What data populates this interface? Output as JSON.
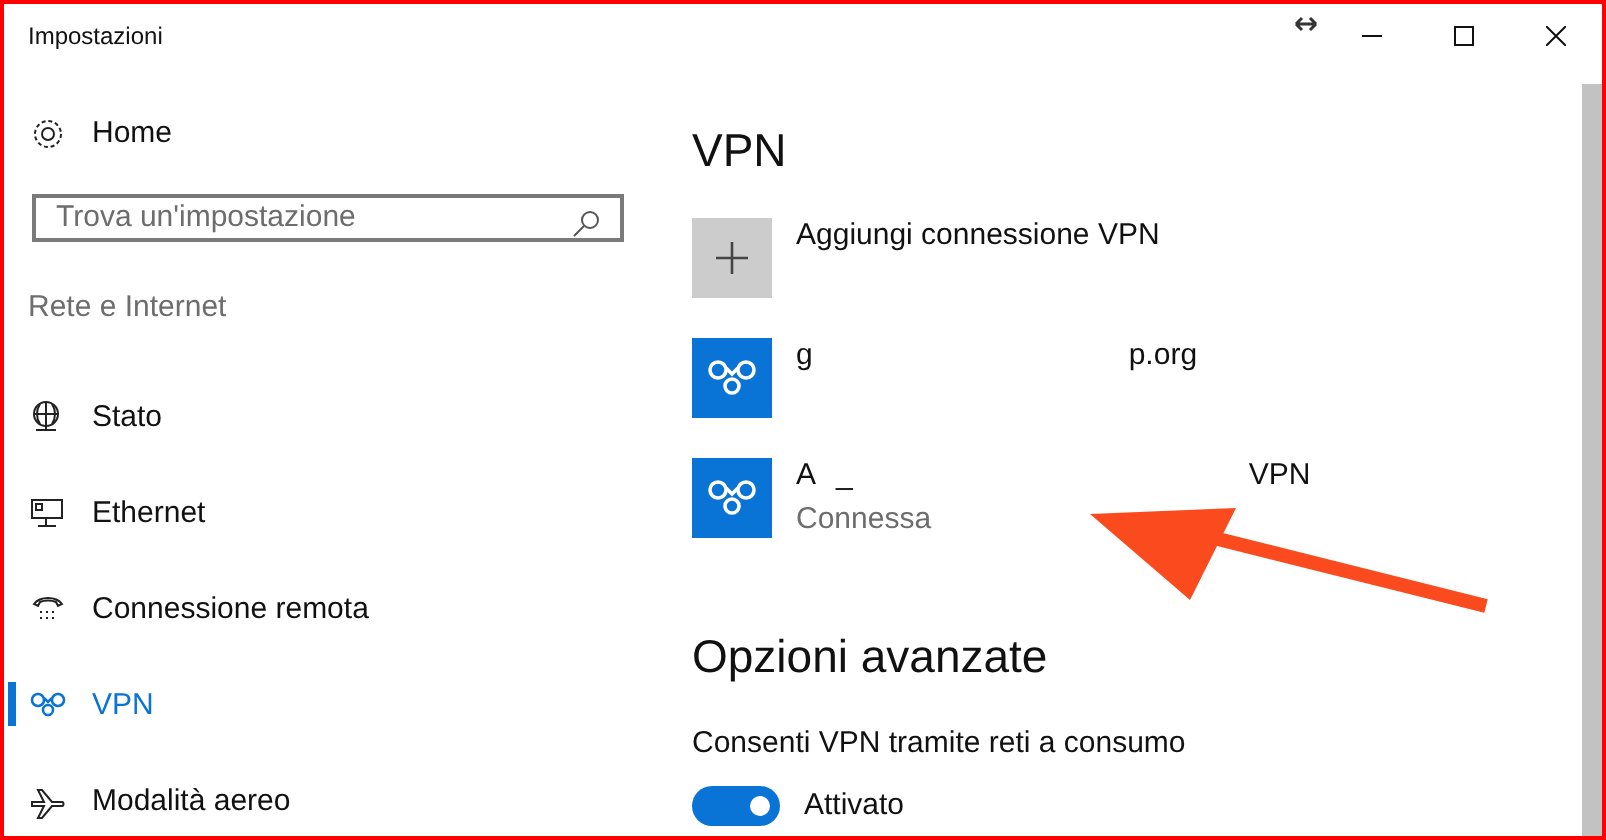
{
  "window": {
    "title": "Impostazioni"
  },
  "sidebar": {
    "home": "Home",
    "search": {
      "placeholder": "Trova un'impostazione"
    },
    "section": "Rete e Internet",
    "items": [
      {
        "label": "Stato",
        "kind": "globe",
        "selected": false
      },
      {
        "label": "Ethernet",
        "kind": "ethernet",
        "selected": false
      },
      {
        "label": "Connessione remota",
        "kind": "phone",
        "selected": false
      },
      {
        "label": "VPN",
        "kind": "vpn",
        "selected": true
      },
      {
        "label": "Modalità aereo",
        "kind": "plane",
        "selected": false
      }
    ]
  },
  "main": {
    "title": "VPN",
    "connections": [
      {
        "kind": "add",
        "name_parts": [
          "Aggiungi connessione VPN"
        ]
      },
      {
        "kind": "vpn",
        "name_parts": [
          "g",
          "p.org"
        ]
      },
      {
        "kind": "vpn",
        "name_parts": [
          "A",
          "_",
          "VPN"
        ],
        "status": "Connessa"
      }
    ],
    "advanced_title": "Opzioni avanzate",
    "setting": {
      "label": "Consenti VPN tramite reti a consumo",
      "on": true,
      "state_text": "Attivato"
    }
  }
}
